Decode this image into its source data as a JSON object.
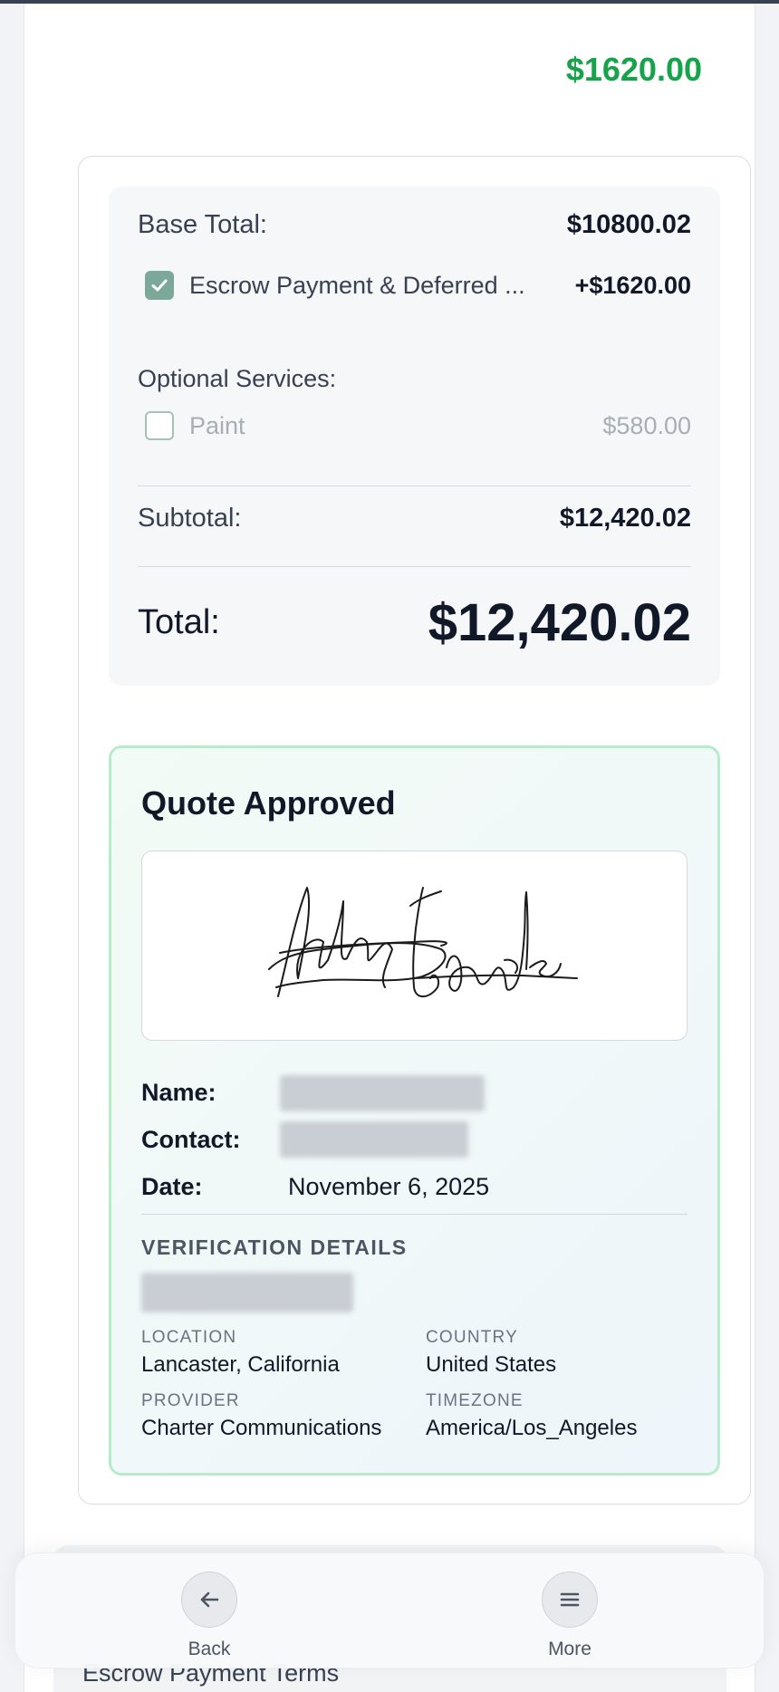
{
  "header": {
    "amount": "$1620.00"
  },
  "summary": {
    "base_total_label": "Base Total:",
    "base_total_value": "$10800.02",
    "escrow_label": "Escrow Payment & Deferred ...",
    "escrow_amount": "+$1620.00",
    "escrow_checked": true,
    "optional_label": "Optional Services:",
    "optional_items": [
      {
        "label": "Paint",
        "amount": "$580.00",
        "checked": false
      }
    ],
    "subtotal_label": "Subtotal:",
    "subtotal_value": "$12,420.02",
    "total_label": "Total:",
    "total_value": "$12,420.02"
  },
  "approval": {
    "title": "Quote Approved",
    "name_label": "Name:",
    "contact_label": "Contact:",
    "date_label": "Date:",
    "date_value": "November 6, 2025",
    "verification_title": "VERIFICATION DETAILS",
    "details": {
      "location_label": "LOCATION",
      "location_value": "Lancaster, California",
      "country_label": "COUNTRY",
      "country_value": "United States",
      "provider_label": "PROVIDER",
      "provider_value": "Charter Communications",
      "timezone_label": "TIMEZONE",
      "timezone_value": "America/Los_Angeles"
    }
  },
  "next_section": {
    "title": "Escrow Payment Terms"
  },
  "nav": {
    "back_label": "Back",
    "more_label": "More",
    "back_icon": "arrow-left-icon",
    "more_icon": "menu-icon"
  },
  "colors": {
    "accent_green": "#16a34a",
    "checkbox_checked": "#7ba899",
    "approved_border": "#b6ecc9"
  }
}
